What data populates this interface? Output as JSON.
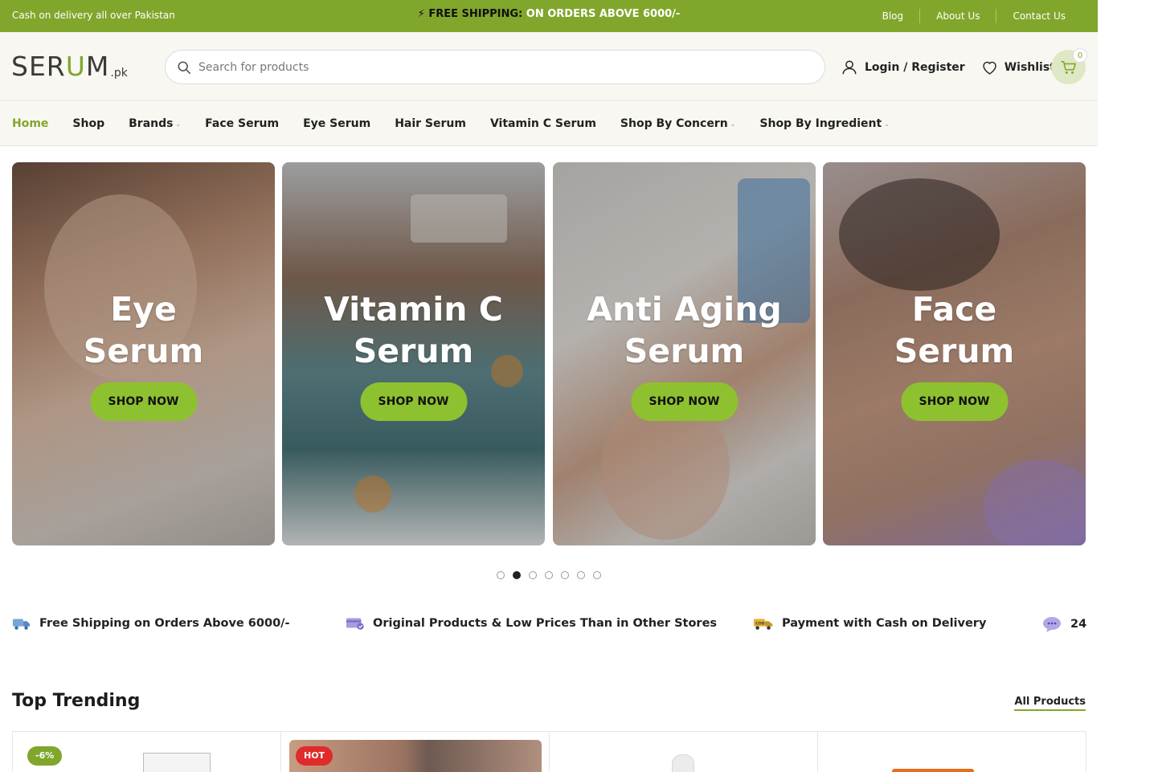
{
  "topbar": {
    "left_text": "Cash on delivery all over Pakistan",
    "promo_label": "FREE SHIPPING:",
    "promo_value": "ON ORDERS ABOVE 6000/-",
    "links": [
      "Blog",
      "About Us",
      "Contact Us"
    ]
  },
  "header": {
    "logo_main_1": "SER",
    "logo_main_u": "U",
    "logo_main_2": "M",
    "logo_tld": ".pk",
    "search_placeholder": "Search for products",
    "login_label": "Login / Register",
    "wishlist_label": "Wishlist",
    "cart_count": "0"
  },
  "nav": {
    "items": [
      {
        "label": "Home",
        "active": true
      },
      {
        "label": "Shop"
      },
      {
        "label": "Brands",
        "dropdown": true
      },
      {
        "label": "Face Serum"
      },
      {
        "label": "Eye Serum"
      },
      {
        "label": "Hair Serum"
      },
      {
        "label": "Vitamin C Serum"
      },
      {
        "label": "Shop By Concern",
        "dropdown": true
      },
      {
        "label": "Shop By Ingredient",
        "dropdown": true
      }
    ],
    "caret": "⌄"
  },
  "banners": [
    {
      "line1": "Eye",
      "line2": "Serum",
      "button": "SHOP NOW"
    },
    {
      "line1": "Vitamin C",
      "line2": "Serum",
      "button": "SHOP NOW"
    },
    {
      "line1": "Anti Aging",
      "line2": "Serum",
      "button": "SHOP NOW"
    },
    {
      "line1": "Face",
      "line2": "Serum",
      "button": "SHOP NOW"
    }
  ],
  "carousel": {
    "total": 7,
    "active_index": 1
  },
  "features": [
    {
      "icon": "truck-icon",
      "text": "Free Shipping on Orders Above 6000/-"
    },
    {
      "icon": "card-check-icon",
      "text": "Original Products & Low Prices Than in Other Stores"
    },
    {
      "icon": "cod-truck-icon",
      "text": "Payment with Cash on Delivery"
    },
    {
      "icon": "chat-support-icon",
      "text": "24"
    }
  ],
  "trending": {
    "title": "Top Trending",
    "all_link": "All Products",
    "products": [
      {
        "badge": "-6%",
        "badge_color": "#81a62c"
      },
      {
        "badge": "HOT",
        "badge_color": "#e02b2b"
      },
      {
        "badge": ""
      },
      {
        "badge": ""
      }
    ]
  },
  "colors": {
    "brand_green": "#81a62c",
    "button_green": "#8ec130",
    "hot_red": "#e02b2b"
  }
}
